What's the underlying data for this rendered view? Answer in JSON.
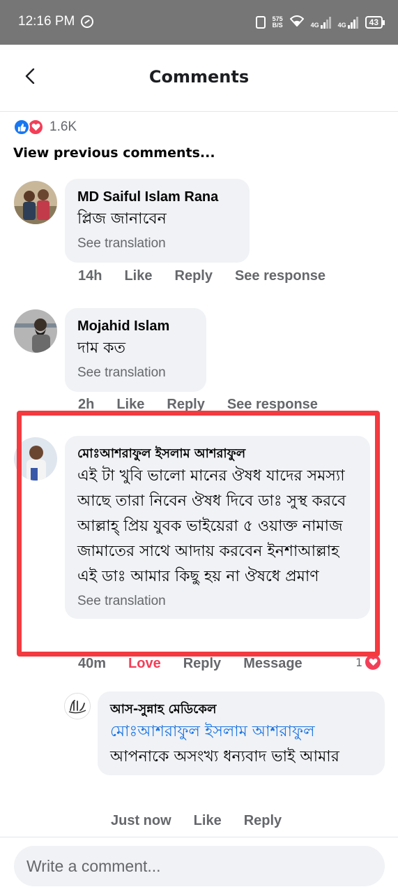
{
  "status_bar": {
    "time": "12:16 PM",
    "net_speed_value": "575",
    "net_speed_unit": "B/S",
    "network_1": "4G",
    "network_2": "4G",
    "battery": "43"
  },
  "header": {
    "title": "Comments"
  },
  "reactions": {
    "count": "1.6K"
  },
  "view_previous": "View previous comments...",
  "comments": [
    {
      "author": "MD Saiful Islam Rana",
      "text": "প্লিজ জানাবেন",
      "see_translation": "See translation",
      "time": "14h",
      "like": "Like",
      "reply": "Reply",
      "see_response": "See response"
    },
    {
      "author": "Mojahid Islam",
      "text": "দাম কত",
      "see_translation": "See translation",
      "time": "2h",
      "like": "Like",
      "reply": "Reply",
      "see_response": "See response"
    },
    {
      "author": "মোঃআশরাফুল ইসলাম আশরাফুল",
      "text": "এই টা খুবি ভালো মানের ঔষধ যাদের সমস্যা আছে তারা নিবেন ঔষধ দিবে ডাঃ সুস্থ করবে আল্লাহ্ প্রিয় যুবক ভাইয়েরা ৫ ওয়াক্ত নামাজ জামাতের সাথে আদায় করবেন ইনশাআল্লাহ এই ডাঃ আমার কিছু হয় না ঔষধে প্রমাণ",
      "see_translation": "See translation",
      "time": "40m",
      "like": "Love",
      "reply": "Reply",
      "message": "Message",
      "reaction_count": "1"
    }
  ],
  "reply": {
    "author": "আস-সুন্নাহ মেডিকেল",
    "mention": "মোঃআশরাফুল ইসলাম আশরাফুল",
    "text": "আপনাকে অসংখ্য ধন্যবাদ ভাই আমার",
    "time": "Just now",
    "like": "Like",
    "reply": "Reply"
  },
  "composer": {
    "placeholder": "Write a comment..."
  },
  "colors": {
    "accent_blue": "#1877f2",
    "love_red": "#f33e58",
    "highlight_red": "#f43a3f",
    "bubble_gray": "#f0f2f5"
  }
}
